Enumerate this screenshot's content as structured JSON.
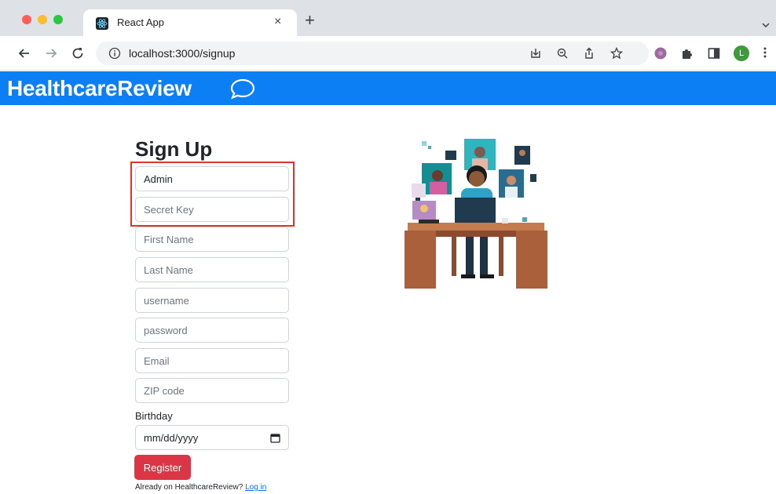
{
  "browser": {
    "tab_title": "React App",
    "tab_close": "×",
    "new_tab": "+",
    "url": "localhost:3000/signup",
    "profile_initial": "L"
  },
  "app": {
    "brand": "HealthcareReview"
  },
  "signup": {
    "title": "Sign Up",
    "admin_value": "Admin",
    "secret_key_placeholder": "Secret Key",
    "first_name_placeholder": "First Name",
    "last_name_placeholder": "Last Name",
    "username_placeholder": "username",
    "password_placeholder": "password",
    "email_placeholder": "Email",
    "zip_placeholder": "ZIP code",
    "birthday_label": "Birthday",
    "birthday_placeholder": "mm/dd/yyyy",
    "register_label": "Register",
    "already_text": "Already on HealthcareReview?",
    "login_link": "Log in"
  },
  "colors": {
    "navbar": "#0d7ff5",
    "register": "#dc3545",
    "highlight": "#d9362f",
    "link": "#0d6efd"
  },
  "icons": [
    "react-favicon-icon",
    "back-arrow-icon",
    "forward-arrow-icon",
    "reload-icon",
    "info-icon",
    "install-icon",
    "zoom-icon",
    "share-icon",
    "bookmark-star-icon",
    "extension-icon",
    "puzzle-icon",
    "side-panel-icon",
    "kebab-menu-icon",
    "chat-bubble-icon",
    "calendar-icon"
  ]
}
